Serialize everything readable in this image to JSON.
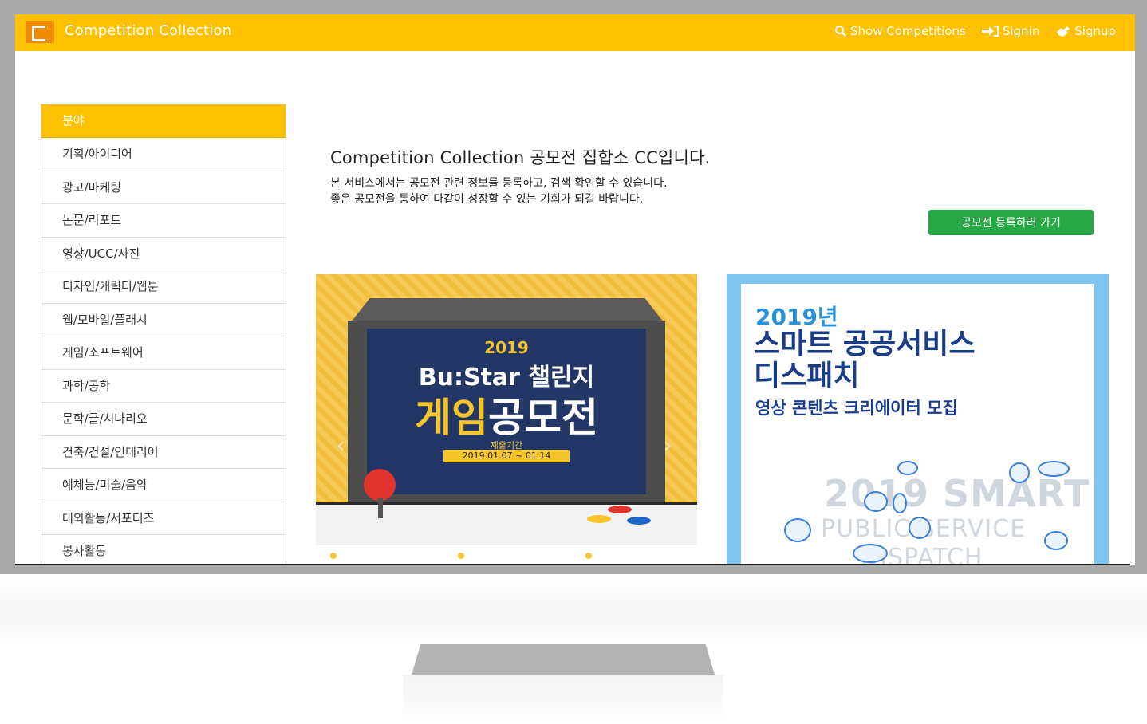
{
  "navbar": {
    "brand": "Competition Collection",
    "links": [
      {
        "label": "Show Competitions",
        "icon": "search-icon"
      },
      {
        "label": "Signin",
        "icon": "sign-in-icon"
      },
      {
        "label": "Signup",
        "icon": "hand-icon"
      }
    ]
  },
  "sidebar": {
    "header": "분야",
    "items": [
      "기획/아이디어",
      "광고/마케팅",
      "논문/리포트",
      "영상/UCC/사진",
      "디자인/캐릭터/웹툰",
      "웹/모바일/플래시",
      "게임/소프트웨어",
      "과학/공학",
      "문학/글/시나리오",
      "건축/건설/인테리어",
      "예체능/미술/음악",
      "대외활동/서포터즈",
      "봉사활동"
    ]
  },
  "intro": {
    "title": "Competition Collection 공모전 집합소 CC입니다.",
    "line1": "본 서비스에서는 공모전 관련 정보를 등록하고, 검색 확인할 수 있습니다.",
    "line2": "좋은 공모전을 통하여 다같이 성장할 수 있는 기회가 되길 바랍니다.",
    "button": "공모전 등록하러 가기"
  },
  "posters": {
    "first": {
      "year": "2019",
      "line1": "Bu:Star 챌린지",
      "line2_accent": "게임",
      "line2_rest": "공모전",
      "period_label": "제출기간",
      "period": "2019.01.07 ~ 01.14"
    },
    "second": {
      "year": "2019년",
      "title_line1": "스마트 공공서비스",
      "title_line2": "디스패치",
      "subtitle": "영상 콘텐츠 크리에이터 모집",
      "watermark1": "2019 SMART",
      "watermark2": "PUBLIC SERVICE",
      "watermark3": "DISPATCH"
    }
  },
  "colors": {
    "brand": "#fec101",
    "logo": "#f08a00",
    "button": "#27a844"
  }
}
